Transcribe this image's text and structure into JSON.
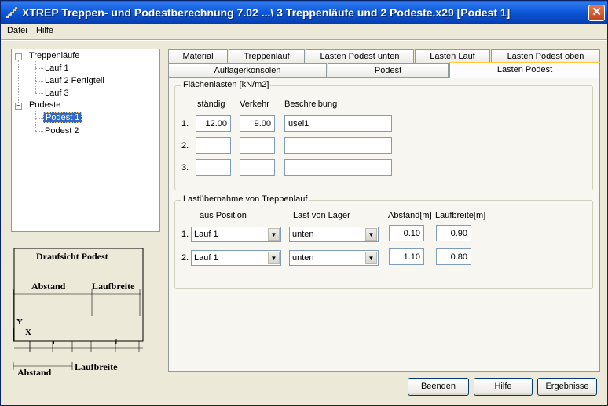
{
  "window": {
    "title": "XTREP Treppen- und Podestberechnung 7.02 ...\\ 3 Treppenläufe und 2 Podeste.x29  [Podest 1]",
    "close_label": "✕"
  },
  "menu": {
    "items": [
      {
        "label": "Datei",
        "hotkey": "D"
      },
      {
        "label": "Hilfe",
        "hotkey": "H"
      }
    ]
  },
  "tree": {
    "groups": [
      {
        "label": "Treppenläufe",
        "expander": "−",
        "children": [
          "Lauf 1",
          "Lauf 2 Fertigteil",
          "Lauf 3"
        ]
      },
      {
        "label": "Podeste",
        "expander": "−",
        "children": [
          "Podest 1",
          "Podest 2"
        ]
      }
    ],
    "selected": "Podest 1"
  },
  "sketch": {
    "title": "Draufsicht Podest",
    "label_abstand": "Abstand",
    "label_laufbreite": "Laufbreite",
    "axis_y": "Y",
    "axis_x": "X",
    "bottom_abstand": "Abstand",
    "bottom_laufbreite": "Laufbreite"
  },
  "tabs": {
    "row_top": [
      "Material",
      "Treppenlauf",
      "Lasten Podest unten",
      "Lasten Lauf",
      "Lasten Podest oben"
    ],
    "row_bottom": [
      "Auflagerkonsolen",
      "Podest",
      "Lasten Podest"
    ],
    "active": "Lasten Podest"
  },
  "flaechenlasten": {
    "title": "Flächenlasten [kN/m2]",
    "col_staendig": "ständig",
    "col_verkehr": "Verkehr",
    "col_beschreibung": "Beschreibung",
    "rows": [
      {
        "num": "1.",
        "staendig": "12.00",
        "verkehr": "9.00",
        "beschreibung": "usel1"
      },
      {
        "num": "2.",
        "staendig": "",
        "verkehr": "",
        "beschreibung": ""
      },
      {
        "num": "3.",
        "staendig": "",
        "verkehr": "",
        "beschreibung": ""
      }
    ]
  },
  "lastuebernahme": {
    "title": "Lastübernahme von Treppenlauf",
    "col_position": "aus Position",
    "col_lager": "Last von Lager",
    "col_abstand": "Abstand[m]",
    "col_laufbreite": "Laufbreite[m]",
    "rows": [
      {
        "num": "1.",
        "position": "Lauf 1",
        "lager": "unten",
        "abstand": "0.10",
        "laufbreite": "0.90"
      },
      {
        "num": "2.",
        "position": "Lauf 1",
        "lager": "unten",
        "abstand": "1.10",
        "laufbreite": "0.80"
      }
    ]
  },
  "buttons": {
    "beenden": "Beenden",
    "hilfe": "Hilfe",
    "ergebnisse": "Ergebnisse"
  }
}
